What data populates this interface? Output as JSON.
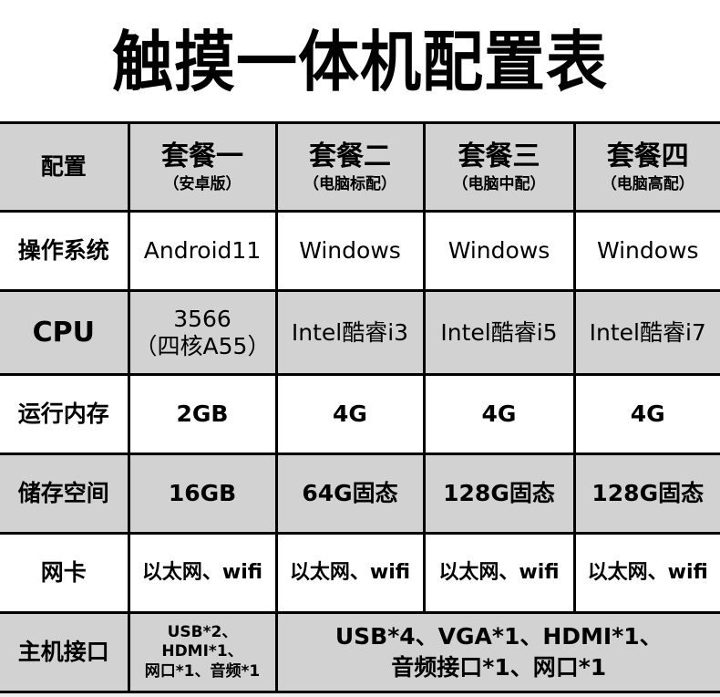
{
  "page": {
    "title": "触摸一体机配置表",
    "background_color": "#f0f0f0",
    "table_background": "#ffffff",
    "shaded_row_color": "#d2d2d2",
    "border_color": "#000000",
    "text_color": "#000000"
  },
  "table": {
    "columns": [
      {
        "label": "配置",
        "sub": ""
      },
      {
        "label": "套餐一",
        "sub": "（安卓版）"
      },
      {
        "label": "套餐二",
        "sub": "（电脑标配）"
      },
      {
        "label": "套餐三",
        "sub": "（电脑中配）"
      },
      {
        "label": "套餐四",
        "sub": "（电脑高配）"
      }
    ],
    "rows": [
      {
        "label": "操作系统",
        "shaded": false,
        "cells": [
          "Android11",
          "Windows",
          "Windows",
          "Windows"
        ]
      },
      {
        "label": "CPU",
        "shaded": true,
        "cells": [
          "3566",
          "Intel酷睿i3",
          "Intel酷睿i5",
          "Intel酷睿i7"
        ],
        "cell_0_line2": "（四核A55）"
      },
      {
        "label": "运行内存",
        "shaded": false,
        "cells": [
          "2GB",
          "4G",
          "4G",
          "4G"
        ]
      },
      {
        "label": "储存空间",
        "shaded": true,
        "cells": [
          "16GB",
          "64G固态",
          "128G固态",
          "128G固态"
        ]
      },
      {
        "label": "网卡",
        "shaded": false,
        "cells": [
          "以太网、wifi",
          "以太网、wifi",
          "以太网、wifi",
          "以太网、wifi"
        ]
      },
      {
        "label": "主机接口",
        "shaded": true,
        "package_one_line1": "USB*2、HDMI*1、",
        "package_one_line2": "网口*1、音频*1",
        "merged_line1": "USB*4、VGA*1、HDMI*1、",
        "merged_line2": "音频接口*1、网口*1"
      }
    ]
  }
}
